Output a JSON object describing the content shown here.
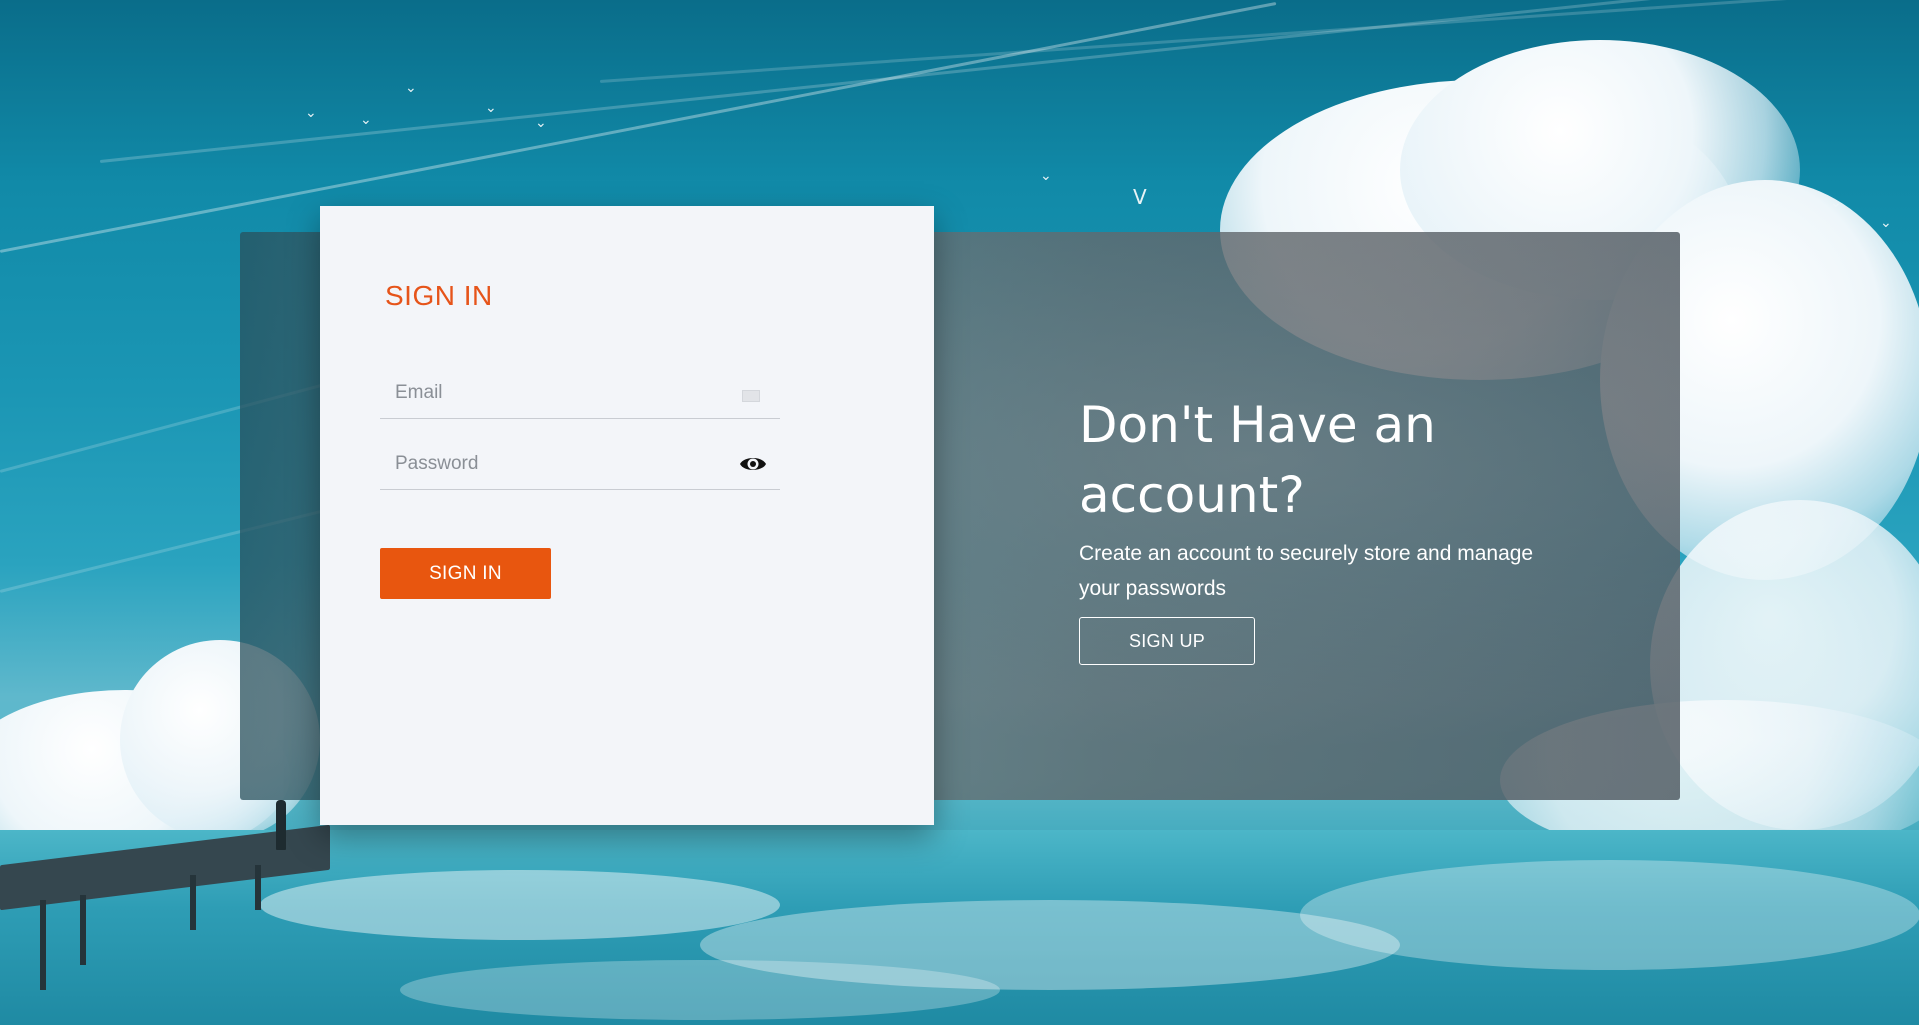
{
  "signin": {
    "title": "SIGN IN",
    "email_placeholder": "Email",
    "password_placeholder": "Password",
    "button_label": "SIGN IN",
    "accent_color": "#e6541a"
  },
  "signup": {
    "heading": "Don't Have an account?",
    "description": "Create an account to securely store and manage your passwords",
    "button_label": "SIGN UP"
  },
  "icons": {
    "email": "mail-icon",
    "password_toggle": "eye-icon"
  }
}
